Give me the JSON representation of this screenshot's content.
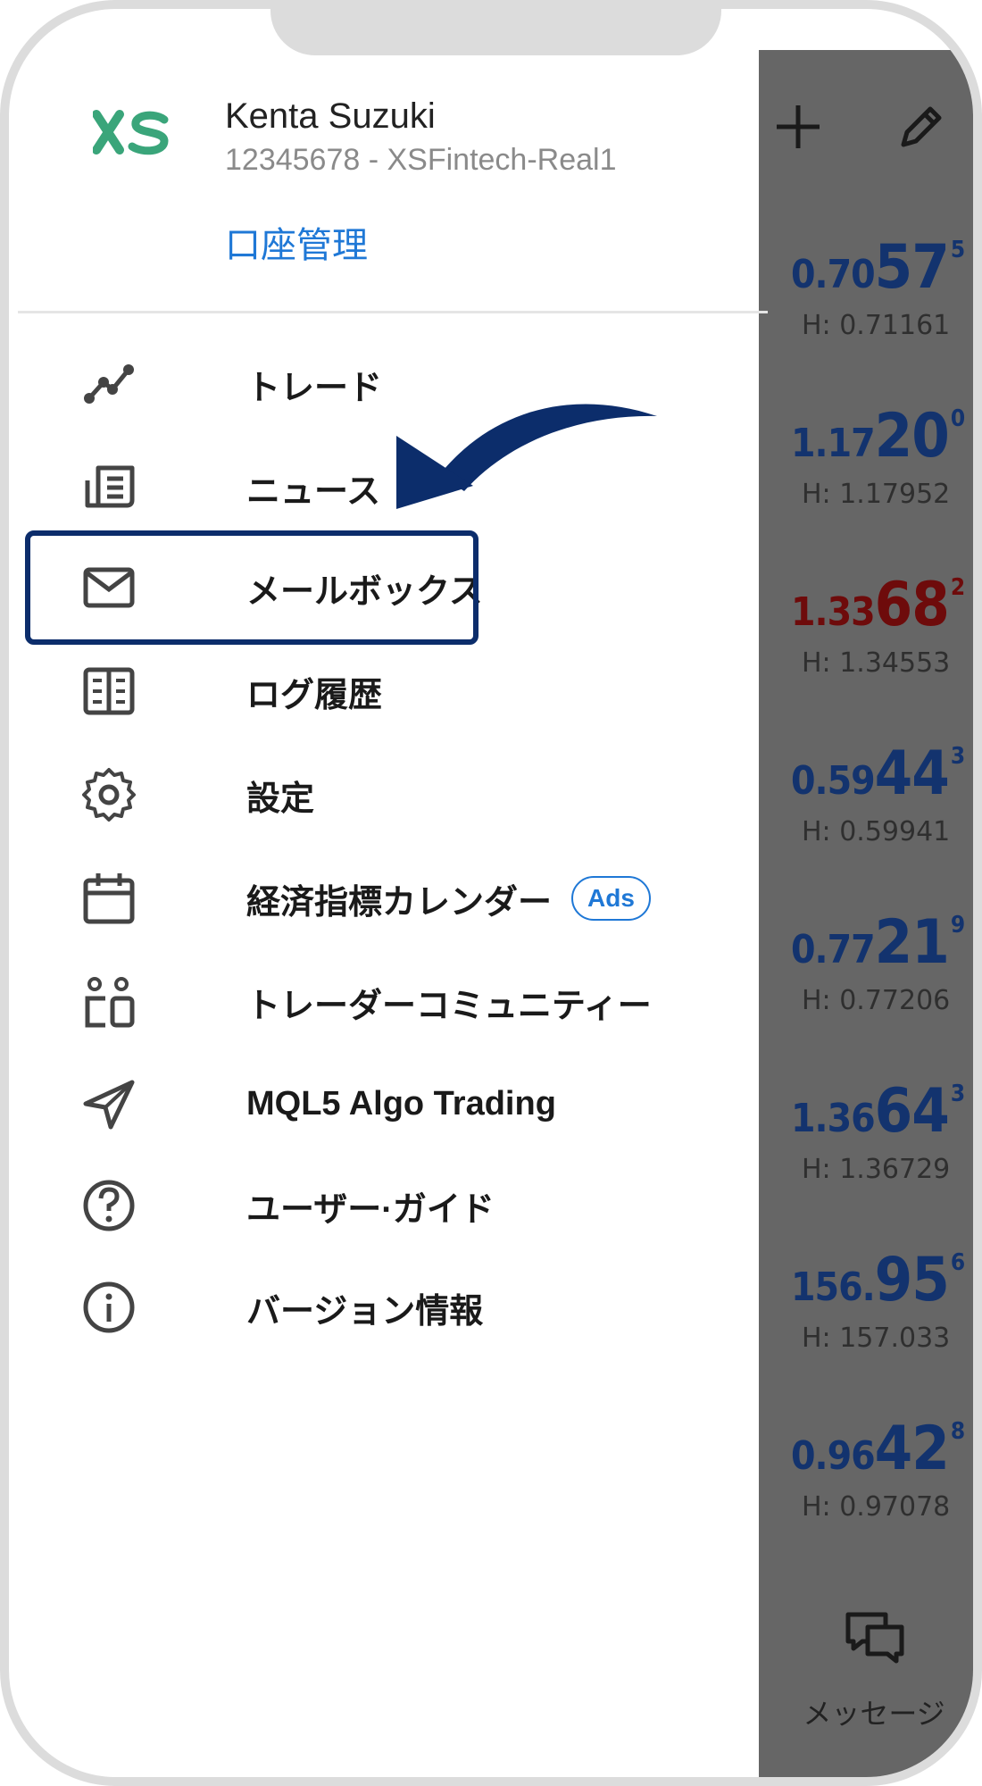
{
  "account": {
    "name": "Kenta Suzuki",
    "details": "12345678 - XSFintech-Real1",
    "manage_link": "口座管理"
  },
  "menu": [
    {
      "label": "トレード",
      "icon": "trade-chart-icon"
    },
    {
      "label": "ニュース",
      "icon": "news-icon"
    },
    {
      "label": "メールボックス",
      "icon": "mail-icon",
      "highlighted": true
    },
    {
      "label": "ログ履歴",
      "icon": "journal-icon"
    },
    {
      "label": "設定",
      "icon": "gear-icon"
    },
    {
      "label": "経済指標カレンダー",
      "icon": "calendar-icon",
      "badge": "Ads"
    },
    {
      "label": "トレーダーコミュニティー",
      "icon": "community-icon"
    },
    {
      "label": "MQL5 Algo Trading",
      "icon": "paper-plane-icon"
    },
    {
      "label": "ユーザー·ガイド",
      "icon": "help-circle-icon"
    },
    {
      "label": "バージョン情報",
      "icon": "info-circle-icon"
    }
  ],
  "quotes": [
    {
      "prefix": "0.70",
      "big": "57",
      "sup": "5",
      "high": "H: 0.71161",
      "color": "blue"
    },
    {
      "prefix": "1.17",
      "big": "20",
      "sup": "0",
      "high": "H: 1.17952",
      "color": "blue"
    },
    {
      "prefix": "1.33",
      "big": "68",
      "sup": "2",
      "high": "H: 1.34553",
      "color": "red"
    },
    {
      "prefix": "0.59",
      "big": "44",
      "sup": "3",
      "high": "H: 0.59941",
      "color": "blue"
    },
    {
      "prefix": "0.77",
      "big": "21",
      "sup": "9",
      "high": "H: 0.77206",
      "color": "blue"
    },
    {
      "prefix": "1.36",
      "big": "64",
      "sup": "3",
      "high": "H: 1.36729",
      "color": "blue"
    },
    {
      "prefix": "156.",
      "big": "95",
      "sup": "6",
      "high": "H: 157.033",
      "color": "blue"
    },
    {
      "prefix": "0.96",
      "big": "42",
      "sup": "8",
      "high": "H: 0.97078",
      "color": "blue"
    }
  ],
  "bottom": {
    "messages_label": "メッセージ"
  },
  "colors": {
    "accent": "#1f78d6",
    "logo_green": "#3aa57a",
    "highlight_border": "#0c2d6b",
    "panel_overlay": "#666666",
    "price_blue": "#13336e",
    "price_red": "#6e0b0b"
  }
}
